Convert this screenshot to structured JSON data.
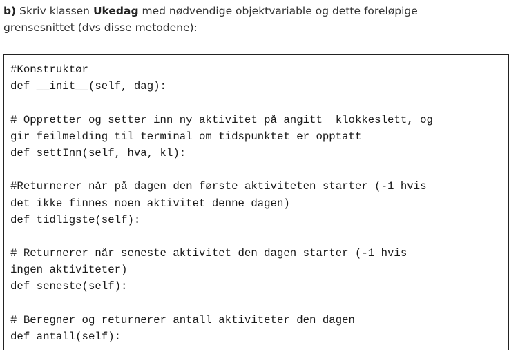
{
  "task": {
    "label": "b)",
    "text_before": " Skriv klassen ",
    "class_name": "Ukedag",
    "text_after": " med nødvendige objektvariable og dette foreløpige grensesnittet (dvs disse metodene):"
  },
  "code_lines": [
    "#Konstruktør",
    "def __init__(self, dag):",
    "",
    "# Oppretter og setter inn ny aktivitet på angitt  klokkeslett, og",
    "gir feilmelding til terminal om tidspunktet er opptatt",
    "def settInn(self, hva, kl):",
    "",
    "#Returnerer når på dagen den første aktiviteten starter (-1 hvis",
    "det ikke finnes noen aktivitet denne dagen)",
    "def tidligste(self):",
    "",
    "# Returnerer når seneste aktivitet den dagen starter (-1 hvis",
    "ingen aktiviteter)",
    "def seneste(self):",
    "",
    "# Beregner og returnerer antall aktiviteter den dagen",
    "def antall(self):"
  ]
}
